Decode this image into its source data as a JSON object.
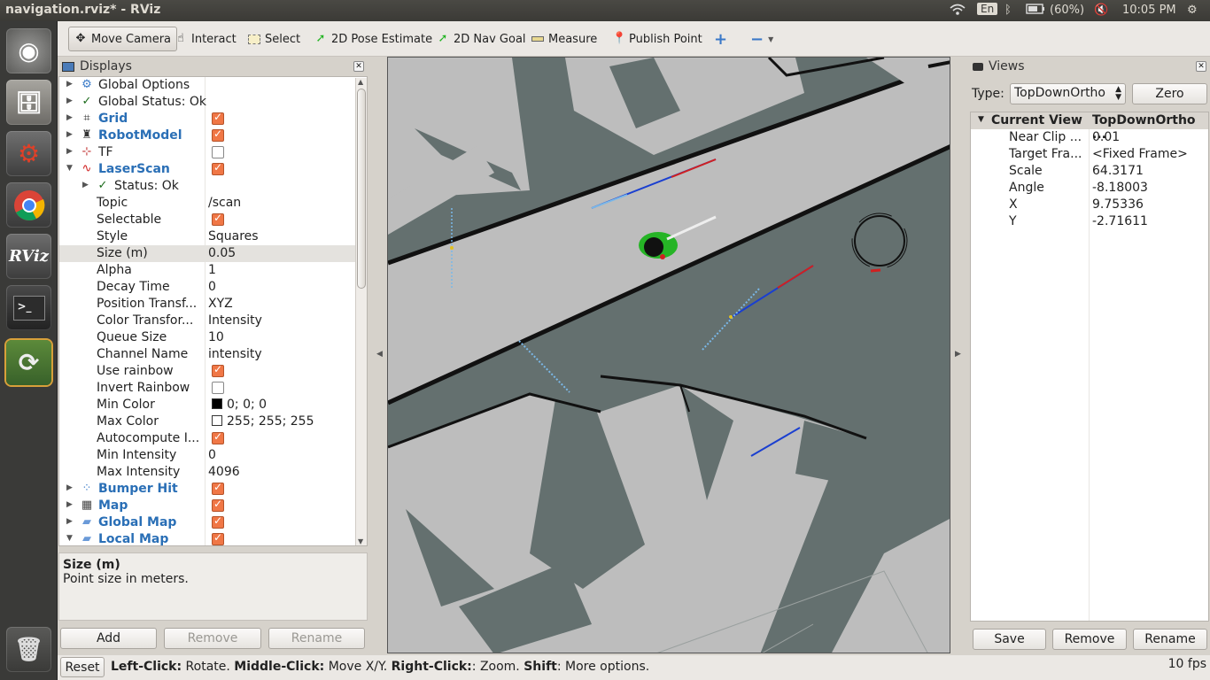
{
  "window": {
    "title": "navigation.rviz* - RViz"
  },
  "tray": {
    "keyboard": "En",
    "battery": "(60%)",
    "clock": "10:05 PM"
  },
  "launcher": {
    "rviz_label": "RViz"
  },
  "toolbar": {
    "tools": [
      {
        "label": "Move Camera",
        "icon": "move-camera-icon",
        "active": true
      },
      {
        "label": "Interact",
        "icon": "hand-icon"
      },
      {
        "label": "Select",
        "icon": "select-rect-icon"
      },
      {
        "label": "2D Pose Estimate",
        "icon": "green-arrow-icon"
      },
      {
        "label": "2D Nav Goal",
        "icon": "green-arrow-icon"
      },
      {
        "label": "Measure",
        "icon": "ruler-icon"
      },
      {
        "label": "Publish Point",
        "icon": "map-pin-icon"
      }
    ],
    "plus": "+",
    "minus": "−"
  },
  "displays": {
    "title": "Displays",
    "rows": [
      {
        "name": "Global Options",
        "indent": 0,
        "arrow": "right",
        "icon": "gear-icon"
      },
      {
        "name": "Global Status: Ok",
        "indent": 0,
        "arrow": "right",
        "icon": "check-icon"
      },
      {
        "name": "Grid",
        "indent": 0,
        "arrow": "right",
        "icon": "grid-icon",
        "blue": true,
        "check": true
      },
      {
        "name": "RobotModel",
        "indent": 0,
        "arrow": "right",
        "icon": "robot-icon",
        "blue": true,
        "check": true
      },
      {
        "name": "TF",
        "indent": 0,
        "arrow": "right",
        "icon": "axes-icon",
        "check": false
      },
      {
        "name": "LaserScan",
        "indent": 0,
        "arrow": "down",
        "icon": "laser-icon",
        "blue": true,
        "check": true
      },
      {
        "name": "Status: Ok",
        "indent": 1,
        "arrow": "right",
        "icon": "check-icon"
      },
      {
        "name": "Topic",
        "indent": 2,
        "value": "/scan"
      },
      {
        "name": "Selectable",
        "indent": 2,
        "check": true
      },
      {
        "name": "Style",
        "indent": 2,
        "value": "Squares"
      },
      {
        "name": "Size (m)",
        "indent": 2,
        "value": "0.05",
        "selected": true
      },
      {
        "name": "Alpha",
        "indent": 2,
        "value": "1"
      },
      {
        "name": "Decay Time",
        "indent": 2,
        "value": "0"
      },
      {
        "name": "Position Transf...",
        "indent": 2,
        "value": "XYZ"
      },
      {
        "name": "Color Transfor...",
        "indent": 2,
        "value": "Intensity"
      },
      {
        "name": "Queue Size",
        "indent": 2,
        "value": "10"
      },
      {
        "name": "Channel Name",
        "indent": 2,
        "value": "intensity"
      },
      {
        "name": "Use rainbow",
        "indent": 2,
        "check": true
      },
      {
        "name": "Invert Rainbow",
        "indent": 2,
        "check": false
      },
      {
        "name": "Min Color",
        "indent": 2,
        "value": "0; 0; 0",
        "swatch": "#000000"
      },
      {
        "name": "Max Color",
        "indent": 2,
        "value": "255; 255; 255",
        "swatch": "#ffffff"
      },
      {
        "name": "Autocompute I...",
        "indent": 2,
        "check": true
      },
      {
        "name": "Min Intensity",
        "indent": 2,
        "value": "0"
      },
      {
        "name": "Max Intensity",
        "indent": 2,
        "value": "4096"
      },
      {
        "name": "Bumper Hit",
        "indent": 0,
        "arrow": "right",
        "icon": "dots-icon",
        "blue": true,
        "check": true
      },
      {
        "name": "Map",
        "indent": 0,
        "arrow": "right",
        "icon": "map-icon",
        "blue": true,
        "check": true
      },
      {
        "name": "Global Map",
        "indent": 0,
        "arrow": "right",
        "icon": "folder-icon",
        "blue": true,
        "check": true
      },
      {
        "name": "Local Map",
        "indent": 0,
        "arrow": "down",
        "icon": "folder-icon",
        "blue": true,
        "check": true
      }
    ],
    "description": {
      "title": "Size (m)",
      "text": "Point size in meters."
    },
    "buttons": {
      "add": "Add",
      "remove": "Remove",
      "rename": "Rename"
    }
  },
  "views": {
    "title": "Views",
    "type_label": "Type:",
    "type_value": "TopDownOrtho",
    "zero": "Zero",
    "header": {
      "key": "Current View",
      "value": "TopDownOrtho ..."
    },
    "props": [
      {
        "k": "Near Clip ...",
        "v": "0.01"
      },
      {
        "k": "Target Fra...",
        "v": "<Fixed Frame>"
      },
      {
        "k": "Scale",
        "v": "64.3171"
      },
      {
        "k": "Angle",
        "v": "-8.18003"
      },
      {
        "k": "X",
        "v": "9.75336"
      },
      {
        "k": "Y",
        "v": "-2.71611"
      }
    ],
    "buttons": {
      "save": "Save",
      "remove": "Remove",
      "rename": "Rename"
    }
  },
  "status": {
    "reset": "Reset",
    "hint_parts": [
      {
        "b": "Left-Click:",
        "t": " Rotate. "
      },
      {
        "b": "Middle-Click:",
        "t": " Move X/Y. "
      },
      {
        "b": "Right-Click:",
        "t": ": Zoom. "
      },
      {
        "b": "Shift",
        "t": ": More options."
      }
    ],
    "fps": "10 fps"
  }
}
